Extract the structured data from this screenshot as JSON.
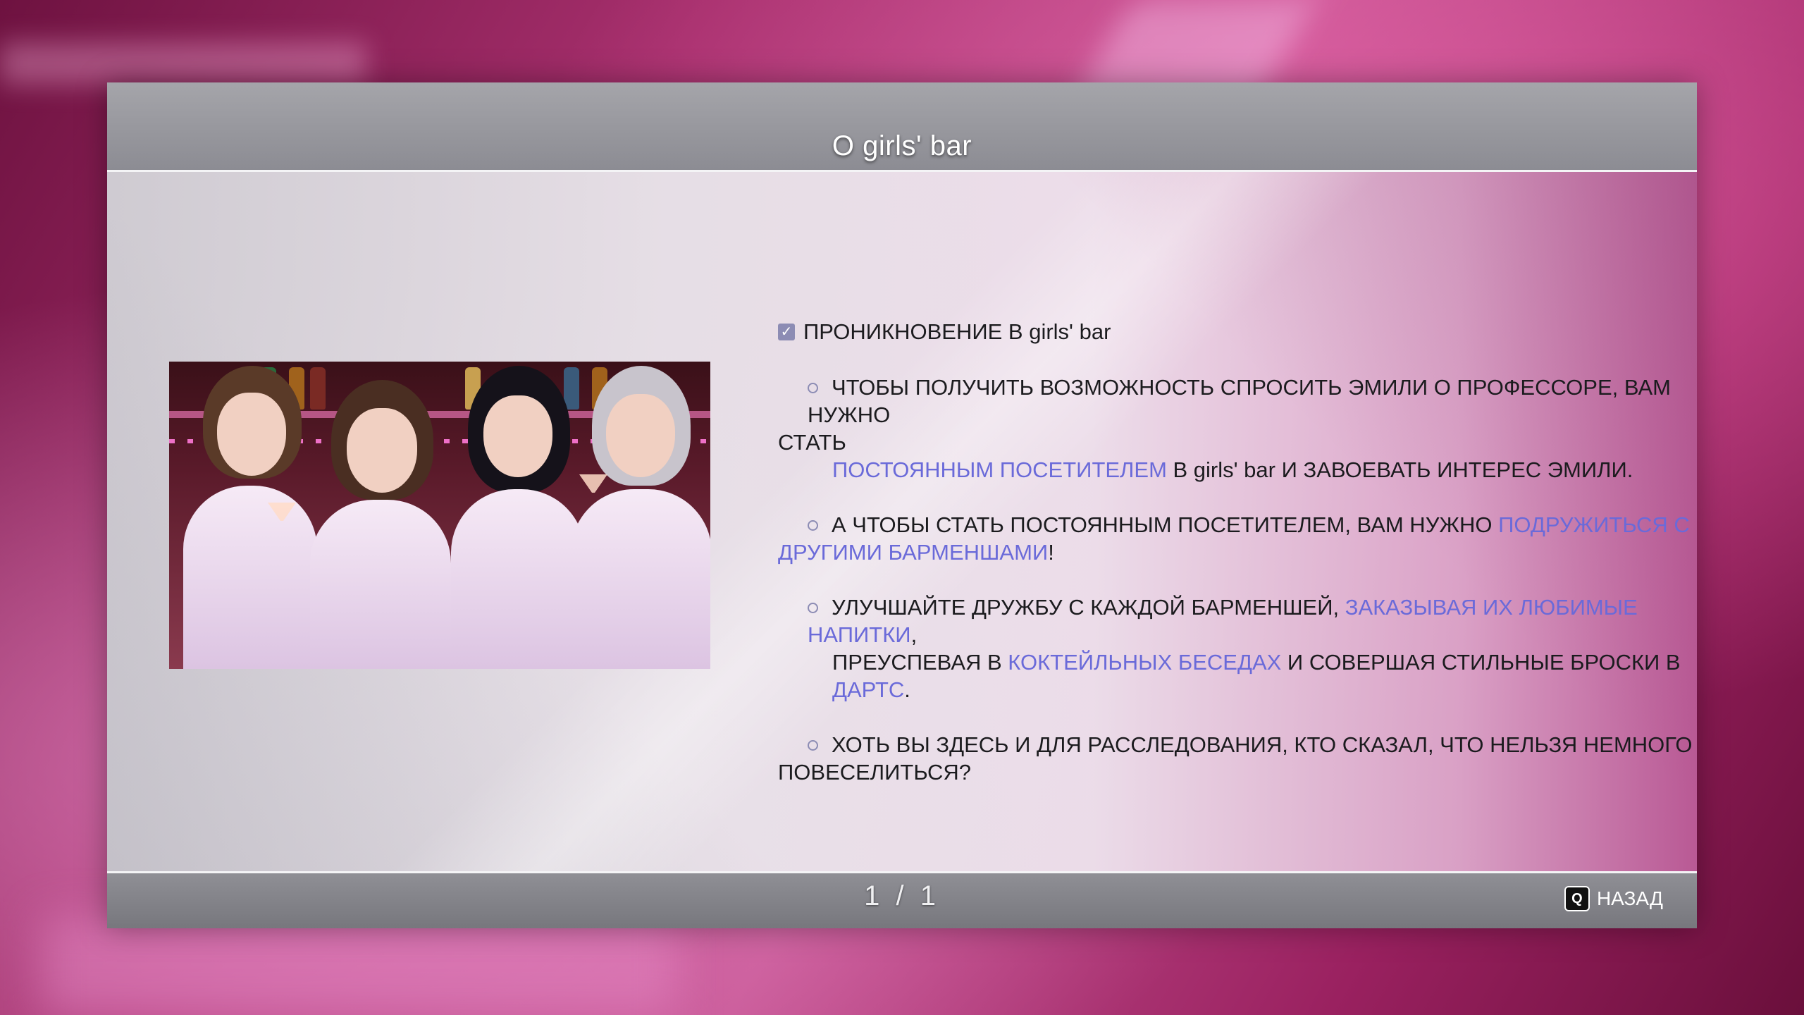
{
  "header": {
    "title": "О girls' bar"
  },
  "section": {
    "heading": "ПРОНИКНОВЕНИЕ В girls' bar"
  },
  "bullets": [
    {
      "line1": "ЧТОБЫ ПОЛУЧИТЬ ВОЗМОЖНОСТЬ СПРОСИТЬ ЭМИЛИ О ПРОФЕССОРЕ, ВАМ НУЖНО",
      "line2": "СТАТЬ",
      "line3_link": "ПОСТОЯННЫМ ПОСЕТИТЕЛЕМ",
      "line3_rest": " В girls' bar И ЗАВОЕВАТЬ ИНТЕРЕС ЭМИЛИ."
    },
    {
      "line1_text": "А ЧТОБЫ СТАТЬ ПОСТОЯННЫМ ПОСЕТИТЕЛЕМ, ВАМ НУЖНО ",
      "line1_link": "ПОДРУЖИТЬСЯ С",
      "line2_link": "ДРУГИМИ БАРМЕНШАМИ",
      "line2_rest": "!"
    },
    {
      "line1_text": "УЛУЧШАЙТЕ ДРУЖБУ С КАЖДОЙ БАРМЕНШЕЙ, ",
      "line1_link": "ЗАКАЗЫВАЯ ИХ ЛЮБИМЫЕ НАПИТКИ",
      "line1_rest": ",",
      "line2_text": "ПРЕУСПЕВАЯ В ",
      "line2_link1": "КОКТЕЙЛЬНЫХ БЕСЕДАХ",
      "line2_mid": " И СОВЕРШАЯ СТИЛЬНЫЕ БРОСКИ В ",
      "line2_link2": "ДАРТС",
      "line2_end": "."
    },
    {
      "line1": "ХОТЬ ВЫ ЗДЕСЬ И ДЛЯ РАССЛЕДОВАНИЯ, КТО СКАЗАЛ, ЧТО НЕЛЬЗЯ НЕМНОГО",
      "line2": "ПОВЕСЕЛИТЬСЯ?"
    }
  ],
  "footer": {
    "page_current": "1",
    "page_sep": "/",
    "page_total": "1",
    "back_key": "Q",
    "back_label": "НАЗАД"
  },
  "colors": {
    "accent_link": "#6a6ad9",
    "bullet_icon": "#8c8cb4"
  },
  "icons": {
    "heading": "checkbox-checked-icon",
    "bullet": "ring-bullet-icon",
    "back": "q-key-icon"
  }
}
